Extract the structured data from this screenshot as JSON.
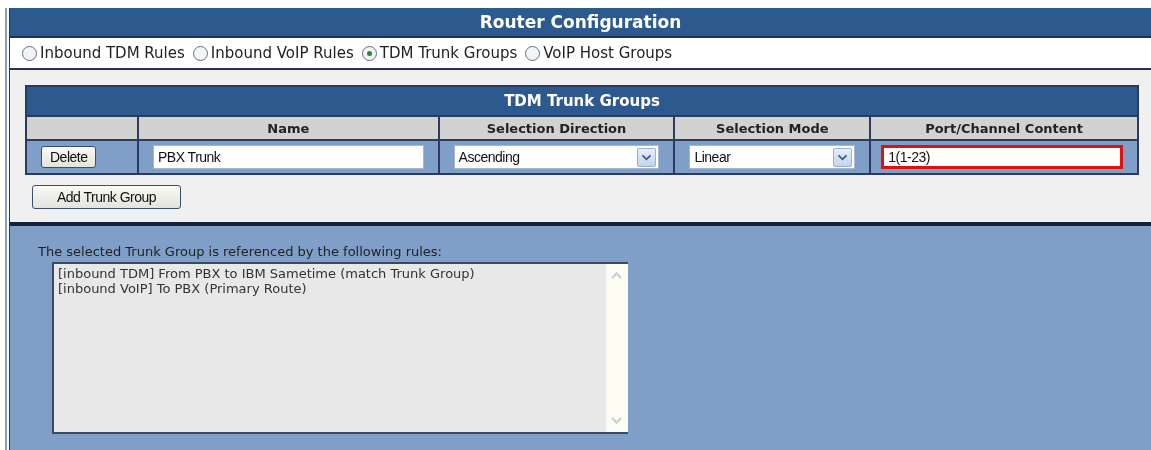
{
  "title": "Router Configuration",
  "views": [
    {
      "label": "Inbound TDM Rules",
      "selected": false
    },
    {
      "label": "Inbound VoIP Rules",
      "selected": false
    },
    {
      "label": "TDM Trunk Groups",
      "selected": true
    },
    {
      "label": "VoIP Host Groups",
      "selected": false
    }
  ],
  "trunk_table": {
    "title": "TDM Trunk Groups",
    "columns": [
      "Name",
      "Selection Direction",
      "Selection Mode",
      "Port/Channel Content"
    ],
    "rows": [
      {
        "delete_button": "Delete",
        "name": "PBX Trunk",
        "direction": "Ascending",
        "mode": "Linear",
        "port_channel": "1(1-23)",
        "invalid": true
      }
    ]
  },
  "add_button": "Add Trunk Group",
  "references": {
    "label": "The selected Trunk Group is referenced by the following rules:",
    "rules": [
      "[inbound TDM] From PBX to IBM Sametime (match Trunk Group)",
      "[inbound VoIP] To PBX (Primary Route)"
    ]
  }
}
